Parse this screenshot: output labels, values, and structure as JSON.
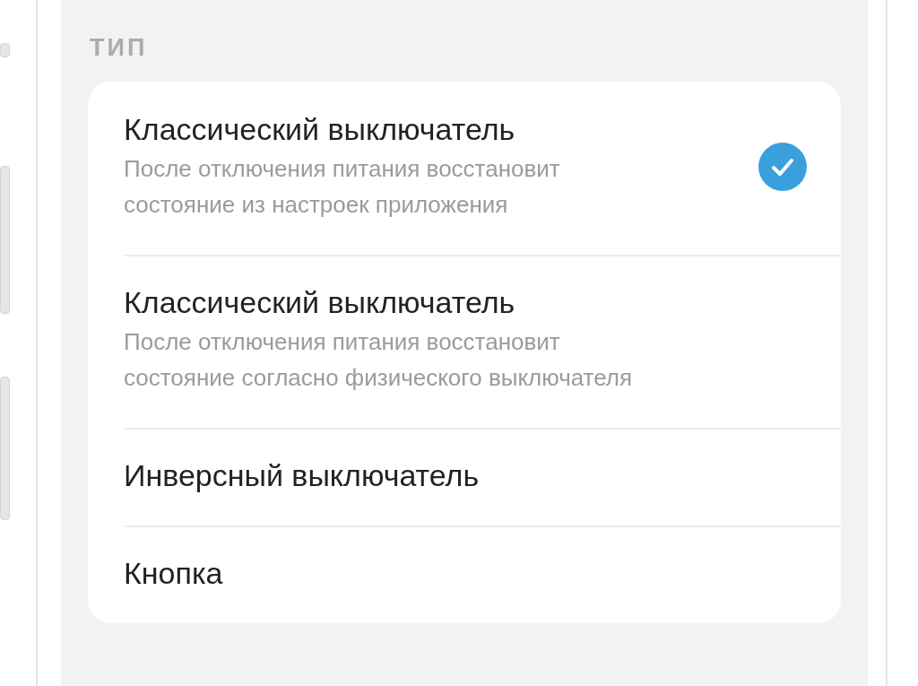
{
  "section_label": "ТИП",
  "options": [
    {
      "title": "Классический выключатель",
      "description": "После отключения питания восстановит состояние из настроек приложения",
      "selected": true
    },
    {
      "title": "Классический выключатель",
      "description": "После отключения питания восстановит состояние согласно физического выключателя",
      "selected": false
    },
    {
      "title": "Инверсный выключатель",
      "selected": false
    },
    {
      "title": "Кнопка",
      "selected": false
    }
  ]
}
